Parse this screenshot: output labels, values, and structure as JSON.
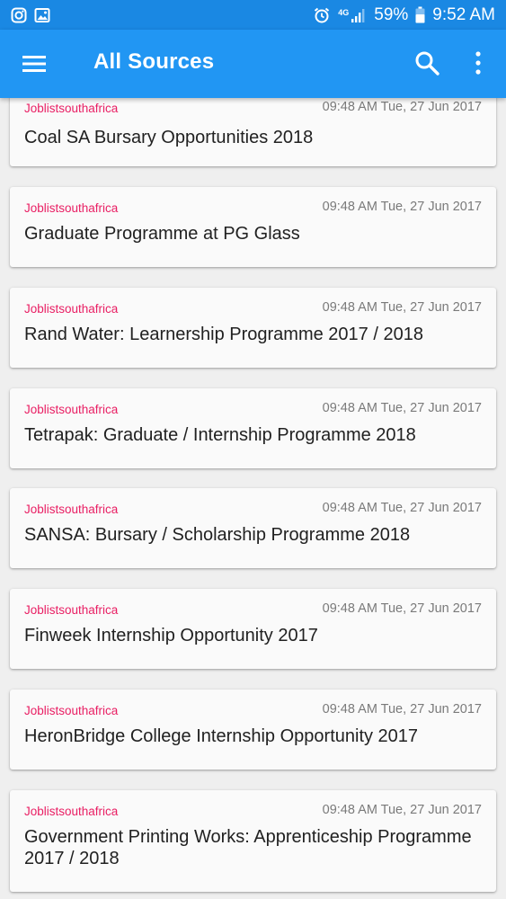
{
  "status_bar": {
    "left_icons": [
      "instagram-icon",
      "image-icon"
    ],
    "network": "4G",
    "battery": "59%",
    "time": "9:52 AM"
  },
  "app_bar": {
    "title": "All Sources"
  },
  "articles": [
    {
      "source": "Joblistsouthafrica",
      "date": "09:48 AM Tue, 27 Jun 2017",
      "title": "Coal SA Bursary Opportunities 2018"
    },
    {
      "source": "Joblistsouthafrica",
      "date": "09:48 AM Tue, 27 Jun 2017",
      "title": "Graduate Programme at PG Glass"
    },
    {
      "source": "Joblistsouthafrica",
      "date": "09:48 AM Tue, 27 Jun 2017",
      "title": "Rand Water: Learnership Programme 2017 / 2018"
    },
    {
      "source": "Joblistsouthafrica",
      "date": "09:48 AM Tue, 27 Jun 2017",
      "title": "Tetrapak: Graduate / Internship Programme 2018"
    },
    {
      "source": "Joblistsouthafrica",
      "date": "09:48 AM Tue, 27 Jun 2017",
      "title": "SANSA: Bursary / Scholarship Programme 2018"
    },
    {
      "source": "Joblistsouthafrica",
      "date": "09:48 AM Tue, 27 Jun 2017",
      "title": "Finweek Internship Opportunity 2017"
    },
    {
      "source": "Joblistsouthafrica",
      "date": "09:48 AM Tue, 27 Jun 2017",
      "title": "HeronBridge College Internship Opportunity 2017"
    },
    {
      "source": "Joblistsouthafrica",
      "date": "09:48 AM Tue, 27 Jun 2017",
      "title": "Government Printing Works: Apprenticeship Programme 2017 / 2018"
    }
  ]
}
